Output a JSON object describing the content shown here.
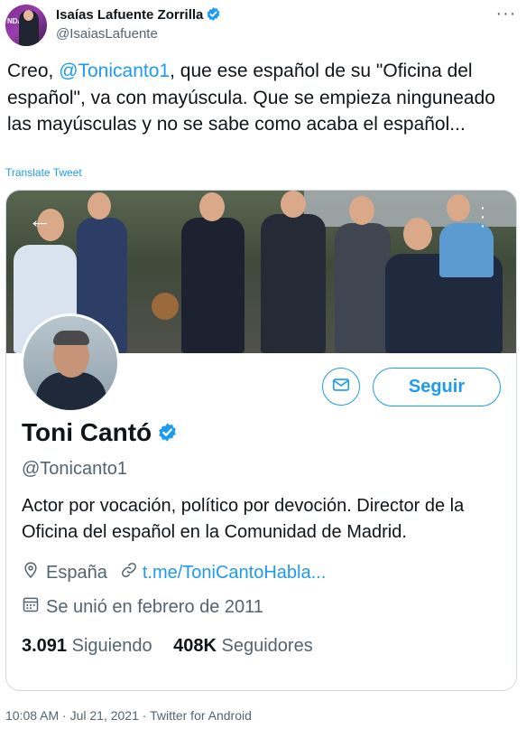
{
  "tweet": {
    "author_name": "Isaías Lafuente Zorrilla",
    "author_handle": "@IsaiasLafuente",
    "avatar_text": "NDA E A",
    "text_before": "Creo, ",
    "mention": "@Tonicanto1",
    "text_after": ", que ese español de su \"Oficina del español\", va con mayúscula. Que se empieza ninguneado las mayúsculas y no se sabe como acaba el español...",
    "translate_label": "Translate Tweet",
    "more_icon": "more-dots-icon",
    "timestamp": "10:08 AM · Jul 21, 2021 · Twitter for Android"
  },
  "profile_card": {
    "name": "Toni Cantó",
    "handle": "@Tonicanto1",
    "bio": "Actor por vocación, político por devoción. Director de la Oficina del español en la Comunidad de Madrid.",
    "location": "España",
    "link": "t.me/ToniCantoHabla...",
    "joined": "Se unió en febrero de 2011",
    "following_count": "3.091",
    "following_label": "Siguiendo",
    "followers_count": "408K",
    "followers_label": "Seguidores",
    "follow_button": "Seguir",
    "icons": [
      "back-arrow-icon",
      "more-vertical-icon",
      "mail-icon",
      "verified-badge-icon",
      "location-pin-icon",
      "link-icon",
      "calendar-icon"
    ]
  },
  "colors": {
    "accent": "#1d9bf0",
    "text_primary": "#0f1419",
    "text_secondary": "#536471",
    "border": "#cfd9de"
  }
}
